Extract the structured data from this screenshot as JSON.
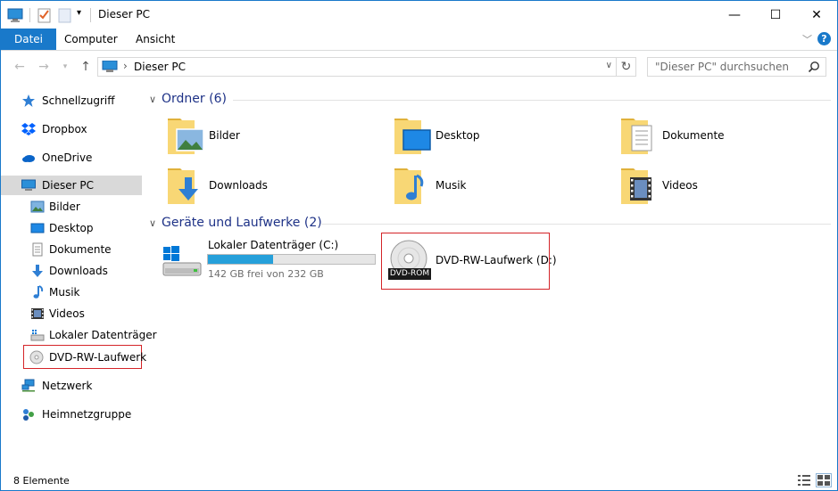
{
  "window": {
    "title": "Dieser PC",
    "minimize": "—",
    "maximize": "☐",
    "close": "✕"
  },
  "ribbon": {
    "tabs": [
      {
        "label": "Datei"
      },
      {
        "label": "Computer"
      },
      {
        "label": "Ansicht"
      }
    ],
    "help": "?"
  },
  "addressbar": {
    "path": "Dieser PC",
    "search_placeholder": "\"Dieser PC\" durchsuchen"
  },
  "navpane": {
    "items": [
      {
        "label": "Schnellzugriff",
        "icon": "star-icon"
      },
      {
        "label": "Dropbox",
        "icon": "dropbox-icon"
      },
      {
        "label": "OneDrive",
        "icon": "cloud-icon"
      },
      {
        "label": "Dieser PC",
        "icon": "computer-icon"
      },
      {
        "label": "Bilder",
        "icon": "pictures-icon"
      },
      {
        "label": "Desktop",
        "icon": "desktop-icon"
      },
      {
        "label": "Dokumente",
        "icon": "documents-icon"
      },
      {
        "label": "Downloads",
        "icon": "downloads-icon"
      },
      {
        "label": "Musik",
        "icon": "music-icon"
      },
      {
        "label": "Videos",
        "icon": "videos-icon"
      },
      {
        "label": "Lokaler Datenträger",
        "icon": "hard-drive-icon"
      },
      {
        "label": "DVD-RW-Laufwerk",
        "icon": "dvd-icon"
      },
      {
        "label": "Netzwerk",
        "icon": "network-icon"
      },
      {
        "label": "Heimnetzgruppe",
        "icon": "homegroup-icon"
      }
    ]
  },
  "content": {
    "folders_header": "Ordner (6)",
    "folders": [
      {
        "label": "Bilder"
      },
      {
        "label": "Desktop"
      },
      {
        "label": "Dokumente"
      },
      {
        "label": "Downloads"
      },
      {
        "label": "Musik"
      },
      {
        "label": "Videos"
      }
    ],
    "drives_header": "Geräte und Laufwerke (2)",
    "drives": [
      {
        "label": "Lokaler Datenträger (C:)",
        "free_text": "142 GB frei von 232 GB",
        "used_fraction": 0.39
      },
      {
        "label": "DVD-RW-Laufwerk (D:)",
        "badge": "DVD-ROM"
      }
    ]
  },
  "status": {
    "count": "8 Elemente"
  },
  "colors": {
    "accent": "#1979ca",
    "selection": "#d9d9d9",
    "highlight_box": "#d42428",
    "progress": "#26a0da",
    "folder": "#f8d775"
  }
}
